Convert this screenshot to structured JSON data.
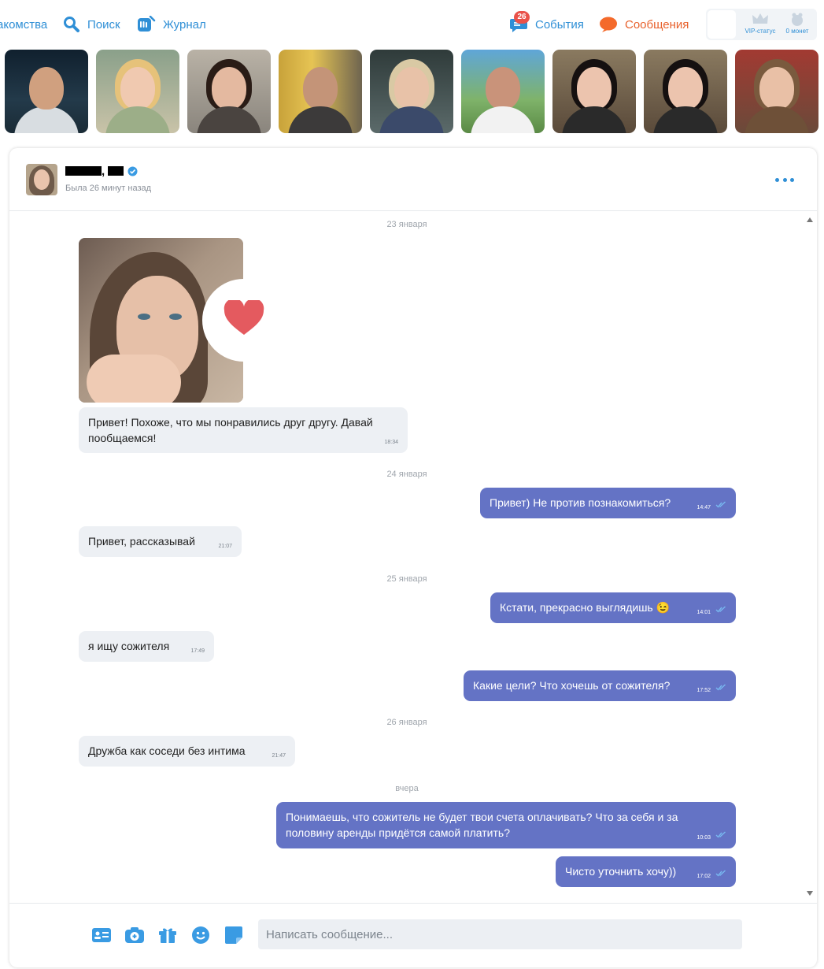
{
  "nav": {
    "dating": "акомства",
    "search": "Поиск",
    "journal": "Журнал",
    "events": "События",
    "events_badge": "26",
    "messages": "Сообщения",
    "vip_status": "VIP-статус",
    "coins": "0 монет",
    "accent_color": "#2f8fd6",
    "messages_color": "#e8612c"
  },
  "chat": {
    "contact_name_suffix": ",",
    "verified_icon": "verified-check-icon",
    "last_seen": "Была 26 минут назад",
    "more_icon": "more-dots-icon",
    "dates": {
      "d1": "23 января",
      "d2": "24 января",
      "d3": "25 января",
      "d4": "26 января",
      "d5": "вчера"
    },
    "messages": {
      "m1": {
        "text": "Привет! Похоже, что мы понравились друг другу. Давай пообщаемся!",
        "time": "18:34"
      },
      "m2": {
        "text": "Привет) Не против познакомиться?",
        "time": "14:47"
      },
      "m3": {
        "text": "Привет, рассказывай",
        "time": "21:07"
      },
      "m4": {
        "text": "Кстати, прекрасно выглядишь 😉",
        "time": "14:01"
      },
      "m5": {
        "text": "я ищу сожителя",
        "time": "17:49"
      },
      "m6": {
        "text": "Какие цели? Что хочешь от сожителя?",
        "time": "17:52"
      },
      "m7": {
        "text": "Дружба как соседи без интима",
        "time": "21:47"
      },
      "m8": {
        "text": "Понимаешь, что сожитель не будет твои счета оплачивать? Что за себя и за половину аренды придётся самой платить?",
        "time": "10:03"
      },
      "m9": {
        "text": "Чисто уточнить хочу))",
        "time": "17:02"
      }
    },
    "outgoing_color": "#6473c5",
    "incoming_color": "#edf0f4"
  },
  "composer": {
    "placeholder": "Написать сообщение...",
    "buttons": [
      "contact-card-icon",
      "camera-icon",
      "gift-icon",
      "emoji-icon",
      "sticker-icon"
    ]
  }
}
